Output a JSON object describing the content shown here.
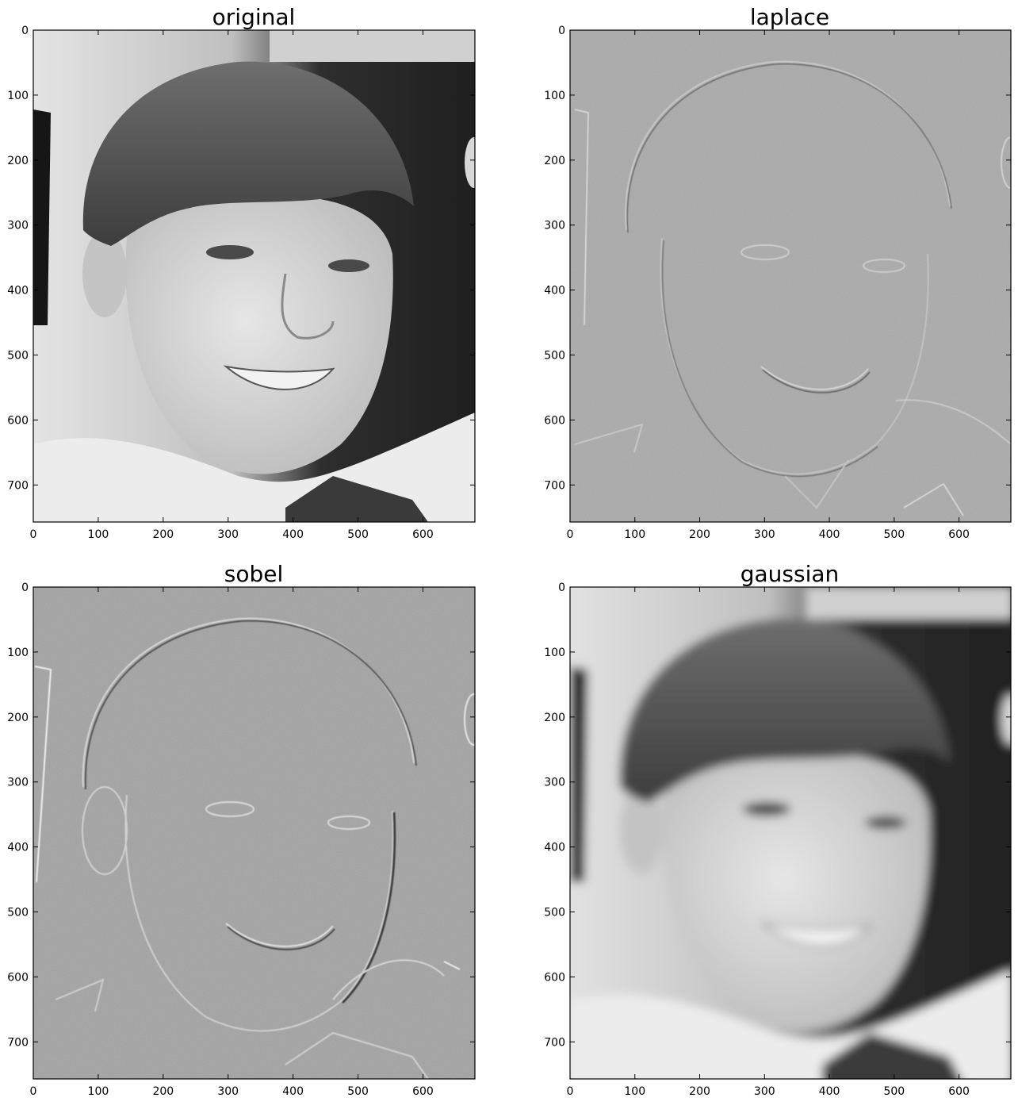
{
  "figure": {
    "panels": [
      {
        "id": "original",
        "title": "original",
        "image_kind": "grayscale photograph",
        "xlim": [
          0,
          680
        ],
        "ylim": [
          757,
          0
        ],
        "xticks": [
          0,
          100,
          200,
          300,
          400,
          500,
          600
        ],
        "yticks": [
          0,
          100,
          200,
          300,
          400,
          500,
          600,
          700
        ]
      },
      {
        "id": "laplace",
        "title": "laplace",
        "image_kind": "laplace edge response",
        "xlim": [
          0,
          680
        ],
        "ylim": [
          757,
          0
        ],
        "xticks": [
          0,
          100,
          200,
          300,
          400,
          500,
          600
        ],
        "yticks": [
          0,
          100,
          200,
          300,
          400,
          500,
          600,
          700
        ]
      },
      {
        "id": "sobel",
        "title": "sobel",
        "image_kind": "sobel edge response",
        "xlim": [
          0,
          680
        ],
        "ylim": [
          757,
          0
        ],
        "xticks": [
          0,
          100,
          200,
          300,
          400,
          500,
          600
        ],
        "yticks": [
          0,
          100,
          200,
          300,
          400,
          500,
          600,
          700
        ]
      },
      {
        "id": "gaussian",
        "title": "gaussian",
        "image_kind": "gaussian blurred photograph",
        "xlim": [
          0,
          680
        ],
        "ylim": [
          757,
          0
        ],
        "xticks": [
          0,
          100,
          200,
          300,
          400,
          500,
          600
        ],
        "yticks": [
          0,
          100,
          200,
          300,
          400,
          500,
          600,
          700
        ]
      }
    ]
  }
}
